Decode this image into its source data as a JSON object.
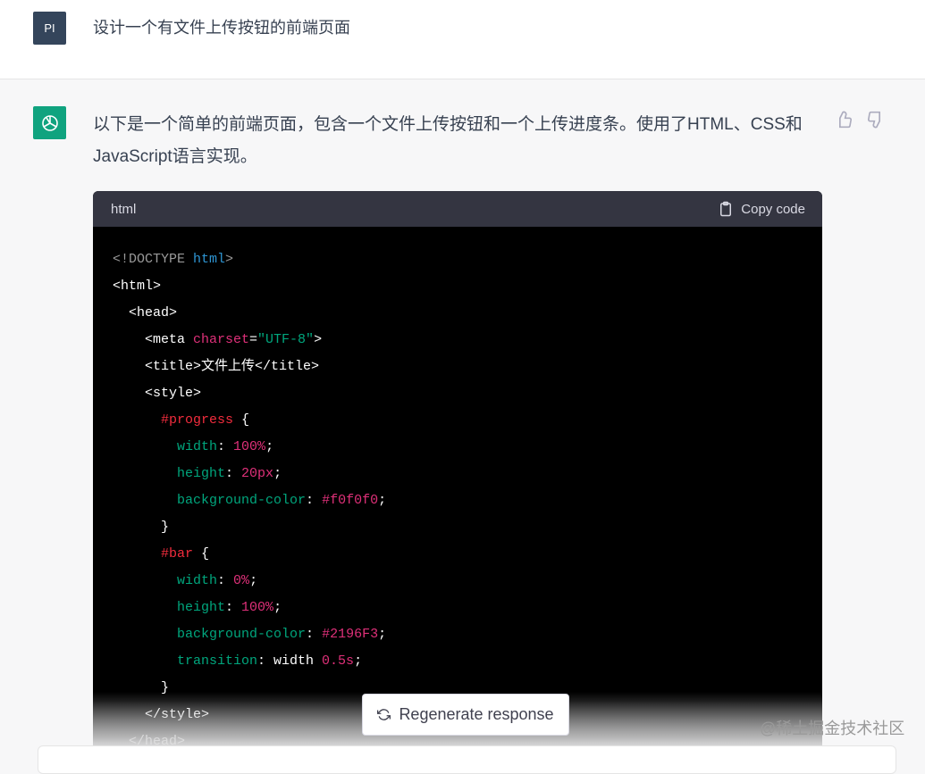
{
  "user": {
    "avatar": "PI",
    "message": "设计一个有文件上传按钮的前端页面"
  },
  "assistant": {
    "message": "以下是一个简单的前端页面，包含一个文件上传按钮和一个上传进度条。使用了HTML、CSS和JavaScript语言实现。"
  },
  "code_block": {
    "language": "html",
    "copy_label": "Copy code",
    "lines": [
      [
        [
          "doc",
          "<!DOCTYPE "
        ],
        [
          "kw",
          "html"
        ],
        [
          "doc",
          ">"
        ]
      ],
      [
        [
          "tag",
          "<html>"
        ]
      ],
      [
        [
          "tag",
          "  <head>"
        ]
      ],
      [
        [
          "tag",
          "    <meta "
        ],
        [
          "attr",
          "charset"
        ],
        [
          "tag",
          "="
        ],
        [
          "str",
          "\"UTF-8\""
        ],
        [
          "tag",
          ">"
        ]
      ],
      [
        [
          "tag",
          "    <title>文件上传</title>"
        ]
      ],
      [
        [
          "tag",
          "    <style>"
        ]
      ],
      [
        [
          "sel",
          "      #progress "
        ],
        [
          "plain",
          "{"
        ]
      ],
      [
        [
          "prop",
          "        width"
        ],
        [
          "plain",
          ": "
        ],
        [
          "val",
          "100%"
        ],
        [
          "plain",
          ";"
        ]
      ],
      [
        [
          "prop",
          "        height"
        ],
        [
          "plain",
          ": "
        ],
        [
          "val",
          "20px"
        ],
        [
          "plain",
          ";"
        ]
      ],
      [
        [
          "prop",
          "        background-color"
        ],
        [
          "plain",
          ": "
        ],
        [
          "val",
          "#f0f0f0"
        ],
        [
          "plain",
          ";"
        ]
      ],
      [
        [
          "plain",
          "      }"
        ]
      ],
      [
        [
          "sel",
          "      #bar "
        ],
        [
          "plain",
          "{"
        ]
      ],
      [
        [
          "prop",
          "        width"
        ],
        [
          "plain",
          ": "
        ],
        [
          "val",
          "0%"
        ],
        [
          "plain",
          ";"
        ]
      ],
      [
        [
          "prop",
          "        height"
        ],
        [
          "plain",
          ": "
        ],
        [
          "val",
          "100%"
        ],
        [
          "plain",
          ";"
        ]
      ],
      [
        [
          "prop",
          "        background-color"
        ],
        [
          "plain",
          ": "
        ],
        [
          "val",
          "#2196F3"
        ],
        [
          "plain",
          ";"
        ]
      ],
      [
        [
          "prop",
          "        transition"
        ],
        [
          "plain",
          ": width "
        ],
        [
          "val",
          "0.5s"
        ],
        [
          "plain",
          ";"
        ]
      ],
      [
        [
          "plain",
          "      }"
        ]
      ],
      [
        [
          "tag",
          "    </style>"
        ]
      ],
      [
        [
          "tag",
          "  </head>"
        ]
      ]
    ]
  },
  "regenerate_label": "Regenerate response",
  "watermark": "@稀土掘金技术社区",
  "colors": {
    "accent": "#10a37f",
    "code_header": "#343541"
  }
}
